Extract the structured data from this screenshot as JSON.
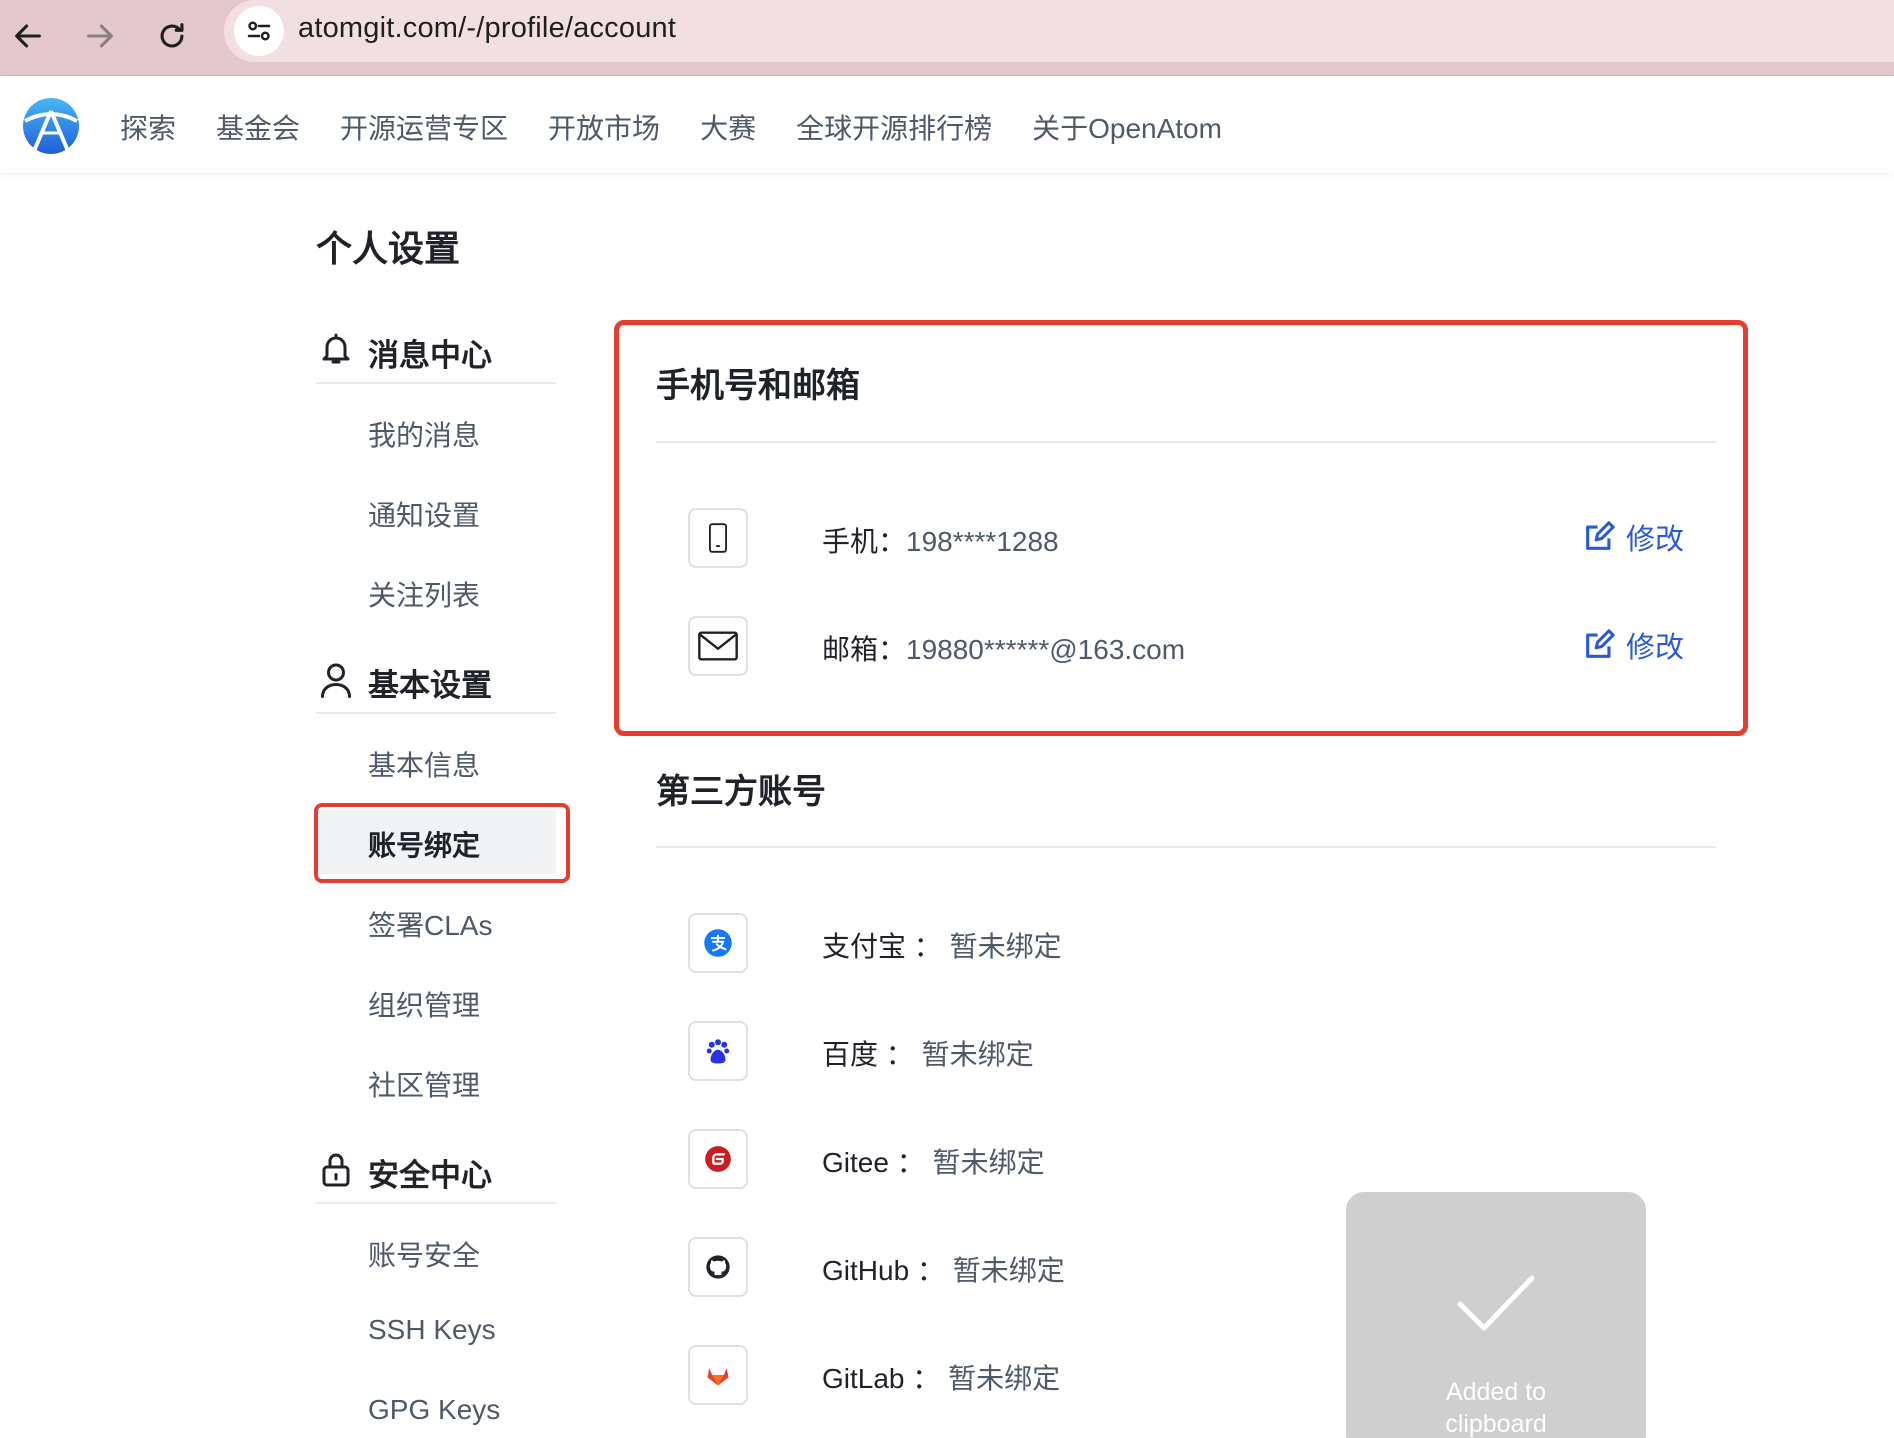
{
  "browser": {
    "url": "atomgit.com/-/profile/account"
  },
  "header": {
    "nav": [
      "探索",
      "基金会",
      "开源运营专区",
      "开放市场",
      "大赛",
      "全球开源排行榜",
      "关于OpenAtom"
    ]
  },
  "page": {
    "title": "个人设置"
  },
  "sidebar": {
    "groups": [
      {
        "label": "消息中心",
        "icon": "bell-icon",
        "items": [
          "我的消息",
          "通知设置",
          "关注列表"
        ]
      },
      {
        "label": "基本设置",
        "icon": "user-icon",
        "items": [
          "基本信息",
          "账号绑定",
          "签署CLAs",
          "组织管理",
          "社区管理"
        ]
      },
      {
        "label": "安全中心",
        "icon": "lock-icon",
        "items": [
          "账号安全",
          "SSH Keys",
          "GPG Keys"
        ]
      }
    ],
    "active_item": "账号绑定"
  },
  "contact": {
    "title": "手机号和邮箱",
    "rows": [
      {
        "label": "手机：",
        "value": "198****1288",
        "action": "修改",
        "icon": "phone-icon"
      },
      {
        "label": "邮箱：",
        "value": "19880******@163.com",
        "action": "修改",
        "icon": "mail-icon"
      }
    ]
  },
  "third_party": {
    "title": "第三方账号",
    "rows": [
      {
        "label": "支付宝 ：",
        "value": "暂未绑定",
        "icon": "alipay-icon",
        "color": "#1677ff"
      },
      {
        "label": "百度 ：",
        "value": "暂未绑定",
        "icon": "baidu-icon",
        "color": "#2932e1"
      },
      {
        "label": "Gitee ：",
        "value": "暂未绑定",
        "icon": "gitee-icon",
        "color": "#c71d23"
      },
      {
        "label": "GitHub ：",
        "value": "暂未绑定",
        "icon": "github-icon",
        "color": "#1f2329"
      },
      {
        "label": "GitLab ：",
        "value": "暂未绑定",
        "icon": "gitlab-icon",
        "color": "#e24329"
      }
    ]
  },
  "toast": {
    "line1": "Added to",
    "line2": "clipboard"
  },
  "colors": {
    "accent": "#2a5bd7",
    "highlight": "#e53e30"
  }
}
